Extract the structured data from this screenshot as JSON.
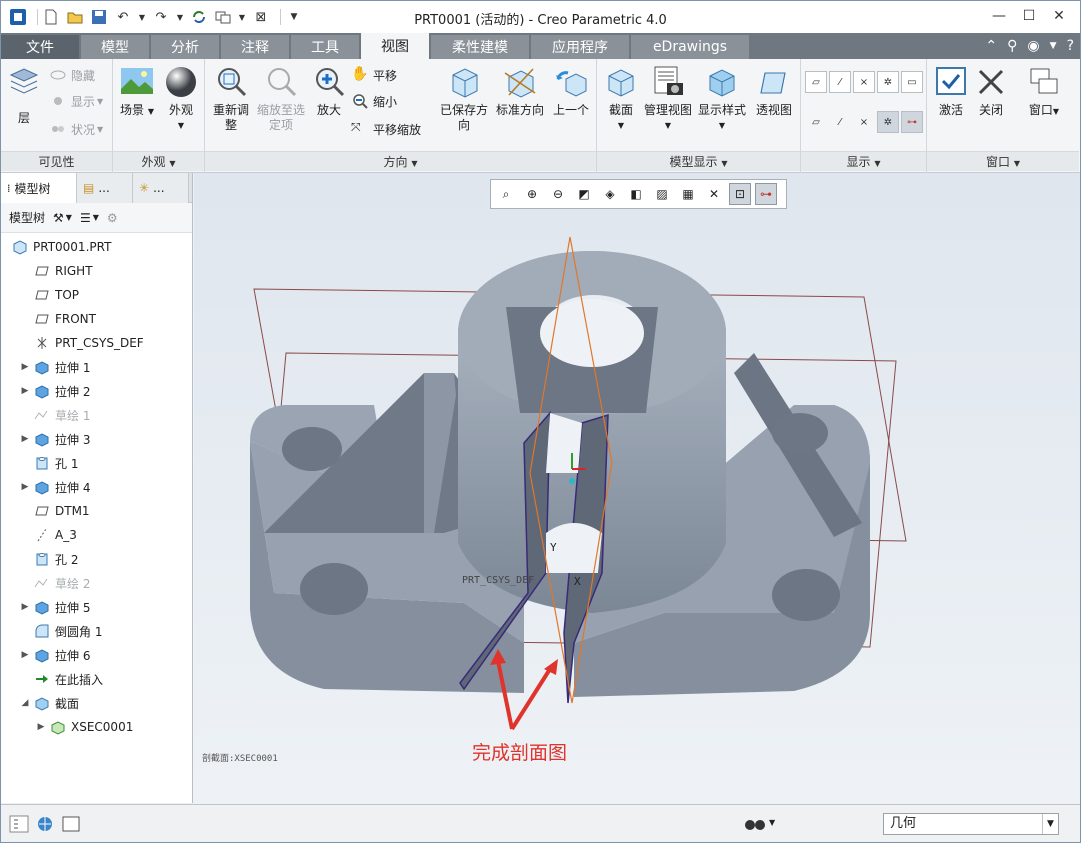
{
  "window": {
    "title": "PRT0001 (活动的) - Creo Parametric 4.0"
  },
  "tabs": [
    "文件",
    "模型",
    "分析",
    "注释",
    "工具",
    "视图",
    "柔性建模",
    "应用程序",
    "eDrawings"
  ],
  "active_tab": "视图",
  "ribbon": {
    "visibility": {
      "layer": "层",
      "hide": "隐藏",
      "show": "显示",
      "status": "状况",
      "label": "可见性"
    },
    "appearance": {
      "scene": "场景",
      "appearance": "外观",
      "label": "外观"
    },
    "orientation": {
      "refit": "重新调整",
      "zoom_to_selected": "缩放至选定项",
      "zoom_in": "放大",
      "pan": "平移",
      "zoom_out": "缩小",
      "pan_zoom": "平移缩放",
      "saved_orientations": "已保存方向",
      "standard_orientation": "标准方向",
      "previous": "上一个",
      "label": "方向"
    },
    "model_display": {
      "section": "截面",
      "manage_views": "管理视图",
      "display_style": "显示样式",
      "perspective": "透视图",
      "label": "模型显示"
    },
    "show": {
      "label": "显示"
    },
    "window": {
      "activate": "激活",
      "close": "关闭",
      "windows": "窗口",
      "label": "窗口"
    }
  },
  "left_panel": {
    "tabs": [
      "模型树",
      "...",
      "..."
    ],
    "toolbar_label": "模型树",
    "tree": [
      {
        "label": "PRT0001.PRT",
        "icon": "part-icon",
        "expand": false,
        "level": 0,
        "dim": false
      },
      {
        "label": "RIGHT",
        "icon": "datum-plane-icon",
        "expand": false,
        "level": 1,
        "dim": false
      },
      {
        "label": "TOP",
        "icon": "datum-plane-icon",
        "expand": false,
        "level": 1,
        "dim": false
      },
      {
        "label": "FRONT",
        "icon": "datum-plane-icon",
        "expand": false,
        "level": 1,
        "dim": false
      },
      {
        "label": "PRT_CSYS_DEF",
        "icon": "csys-icon",
        "expand": false,
        "level": 1,
        "dim": false
      },
      {
        "label": "拉伸 1",
        "icon": "extrude-icon",
        "expand": true,
        "level": 1,
        "dim": false
      },
      {
        "label": "拉伸 2",
        "icon": "extrude-icon",
        "expand": true,
        "level": 1,
        "dim": false
      },
      {
        "label": "草绘 1",
        "icon": "sketch-icon",
        "expand": false,
        "level": 1,
        "dim": true
      },
      {
        "label": "拉伸 3",
        "icon": "extrude-icon",
        "expand": true,
        "level": 1,
        "dim": false
      },
      {
        "label": "孔 1",
        "icon": "hole-icon",
        "expand": false,
        "level": 1,
        "dim": false
      },
      {
        "label": "拉伸 4",
        "icon": "extrude-icon",
        "expand": true,
        "level": 1,
        "dim": false
      },
      {
        "label": "DTM1",
        "icon": "datum-plane-icon",
        "expand": false,
        "level": 1,
        "dim": false
      },
      {
        "label": "A_3",
        "icon": "axis-icon",
        "expand": false,
        "level": 1,
        "dim": false
      },
      {
        "label": "孔 2",
        "icon": "hole-icon",
        "expand": false,
        "level": 1,
        "dim": false
      },
      {
        "label": "草绘 2",
        "icon": "sketch-icon",
        "expand": false,
        "level": 1,
        "dim": true
      },
      {
        "label": "拉伸 5",
        "icon": "extrude-icon",
        "expand": true,
        "level": 1,
        "dim": false
      },
      {
        "label": "倒圆角 1",
        "icon": "round-icon",
        "expand": false,
        "level": 1,
        "dim": false
      },
      {
        "label": "拉伸 6",
        "icon": "extrude-icon",
        "expand": true,
        "level": 1,
        "dim": false
      },
      {
        "label": "在此插入",
        "icon": "insert-arrow-icon",
        "expand": false,
        "level": 1,
        "dim": false
      },
      {
        "label": "截面",
        "icon": "section-folder-icon",
        "expand": "open",
        "level": 1,
        "dim": false
      },
      {
        "label": "XSEC0001",
        "icon": "xsec-icon",
        "expand": true,
        "level": 2,
        "dim": false
      }
    ]
  },
  "viewport": {
    "csys_label": "PRT_CSYS_DEF",
    "section_label": "剖截面:XSEC0001",
    "annotation": "完成剖面图",
    "annotation_color": "#e0332b"
  },
  "statusbar": {
    "filter_value": "几何"
  }
}
